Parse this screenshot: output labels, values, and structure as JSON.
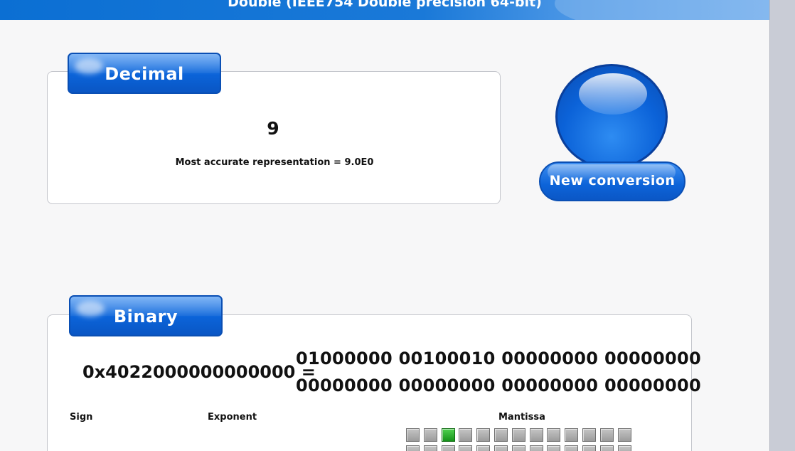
{
  "header": {
    "title": "Double (IEEE754 Double precision 64-bit)"
  },
  "decimal": {
    "tab_label": "Decimal",
    "value": "9",
    "accurate_text": "Most accurate representation = 9.0E0"
  },
  "new_conversion": {
    "label": "New conversion"
  },
  "binary": {
    "tab_label": "Binary",
    "hex_text": "0x4022000000000000 =",
    "line1": "01000000 00100010 00000000 00000000",
    "line2": "00000000 00000000 00000000 00000000",
    "labels": {
      "sign": "Sign",
      "exponent": "Exponent",
      "mantissa": "Mantissa"
    },
    "mantissa_bits_visible": [
      0,
      0,
      1,
      0,
      0,
      0,
      0,
      0,
      0,
      0,
      0,
      0,
      0
    ]
  },
  "colors": {
    "accent_blue": "#0b63d8",
    "bit_on": "#16931a",
    "bit_off": "#a8a8a8"
  }
}
